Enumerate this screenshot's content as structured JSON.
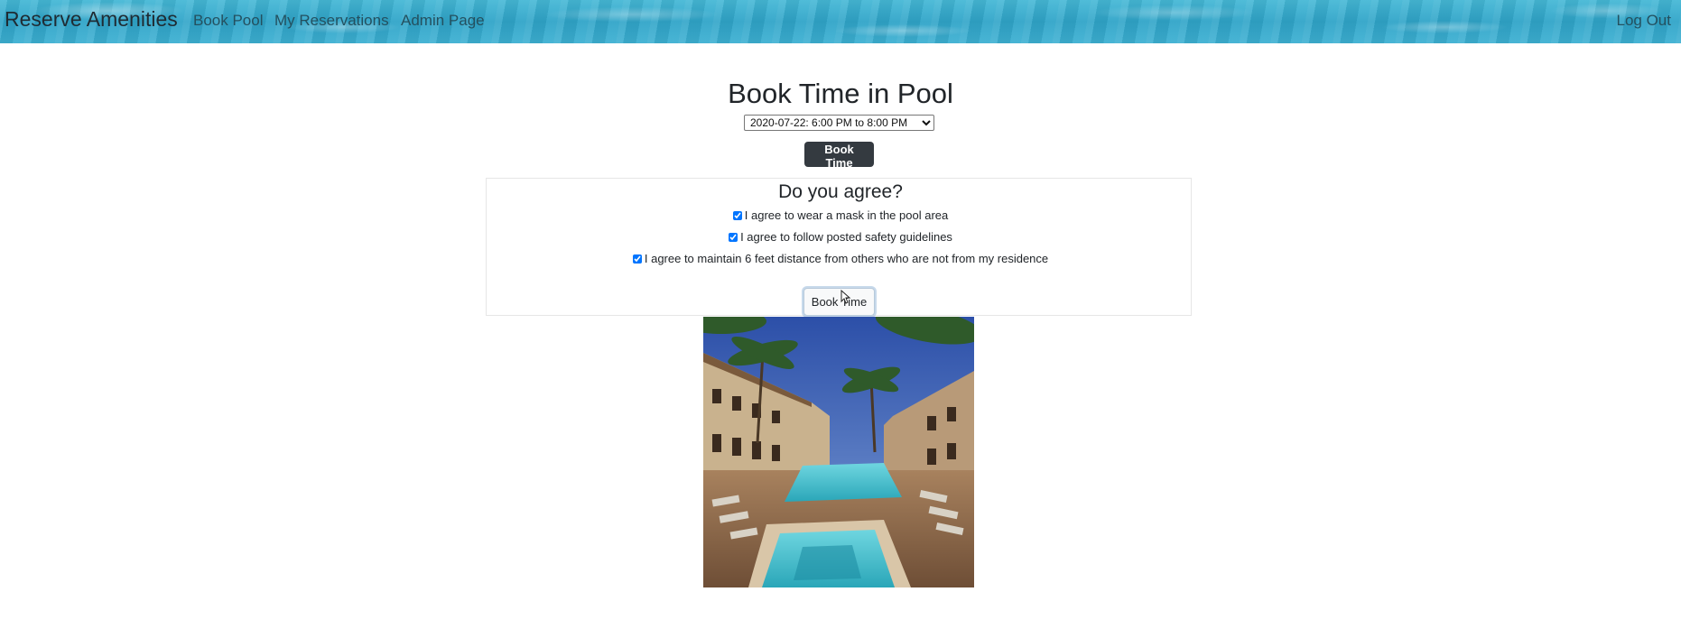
{
  "nav": {
    "brand": "Reserve Amenities",
    "links": [
      "Book Pool",
      "My Reservations",
      "Admin Page"
    ],
    "logout": "Log Out"
  },
  "main": {
    "title": "Book Time in Pool",
    "slot_selected": "2020-07-22: 6:00 PM to 8:00 PM",
    "book_button": "Book Time"
  },
  "agreement": {
    "title": "Do you agree?",
    "items": [
      {
        "label": "I agree to wear a mask in the pool area",
        "checked": true
      },
      {
        "label": "I agree to follow posted safety guidelines",
        "checked": true
      },
      {
        "label": "I agree to maintain 6 feet distance from others who are not from my residence",
        "checked": true
      }
    ],
    "submit_button": "Book Time"
  },
  "colors": {
    "navbar": "#2fa4c8",
    "dark_button": "#343a40"
  }
}
